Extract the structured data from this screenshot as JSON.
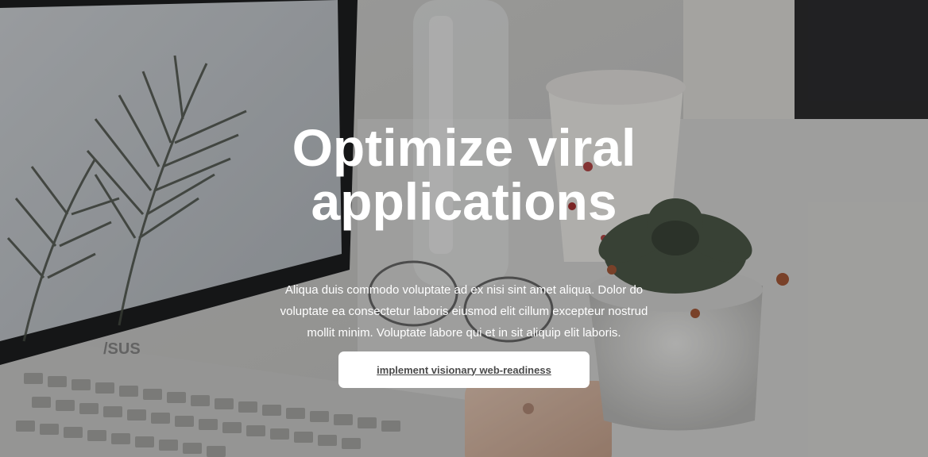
{
  "hero": {
    "background_image": "laptop-desk-photo",
    "headline": "Optimize viral applications",
    "description": "Aliqua duis commodo voluptate ad ex nisi sint amet aliqua. Dolor do voluptate ea consectetur laboris eiusmod elit cillum excepteur nostrud mollit minim. Voluptate labore qui et in sit aliquip elit laboris.",
    "cta_label": "implement visionary web-readiness",
    "photo_brand_text": "/SUS"
  },
  "colors": {
    "headline_text": "#ffffff",
    "button_background": "#ffffff",
    "button_text": "#4a4a4a",
    "overlay": "rgba(0,0,0,0.28)"
  }
}
